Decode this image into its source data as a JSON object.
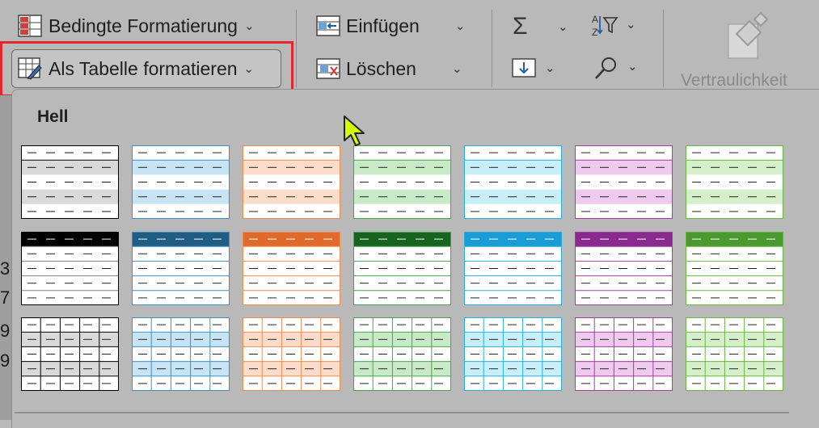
{
  "ribbon": {
    "conditional_formatting": "Bedingte Formatierung",
    "format_as_table": "Als Tabelle formatieren",
    "insert": "Einfügen",
    "delete": "Löschen",
    "sensitivity": "Vertraulichkeit"
  },
  "gallery": {
    "section_title": "Hell",
    "colors": [
      "#808080",
      "#3f8fc6",
      "#ee8c51",
      "#49a44f",
      "#2aaedc",
      "#a23ea3",
      "#6ab442"
    ],
    "tints": [
      "#d9d9d9",
      "#c6e4f3",
      "#fbdccb",
      "#c9eac7",
      "#c8eef8",
      "#efc9ee",
      "#d6efcb"
    ],
    "dark_headers": [
      "#000000",
      "#1f5d82",
      "#e06a2a",
      "#18641f",
      "#1a9dd6",
      "#8a2a8e",
      "#4b9a2f"
    ]
  },
  "sheet": {
    "left_cells": [
      "3,",
      "7,",
      "9,",
      "9,"
    ]
  },
  "icons": {
    "sum": "sum-icon",
    "sort_filter": "sort-filter-icon",
    "fill": "fill-down-icon",
    "find": "find-icon",
    "sensitivity": "sensitivity-icon",
    "cursor": "mouse-pointer-icon"
  }
}
